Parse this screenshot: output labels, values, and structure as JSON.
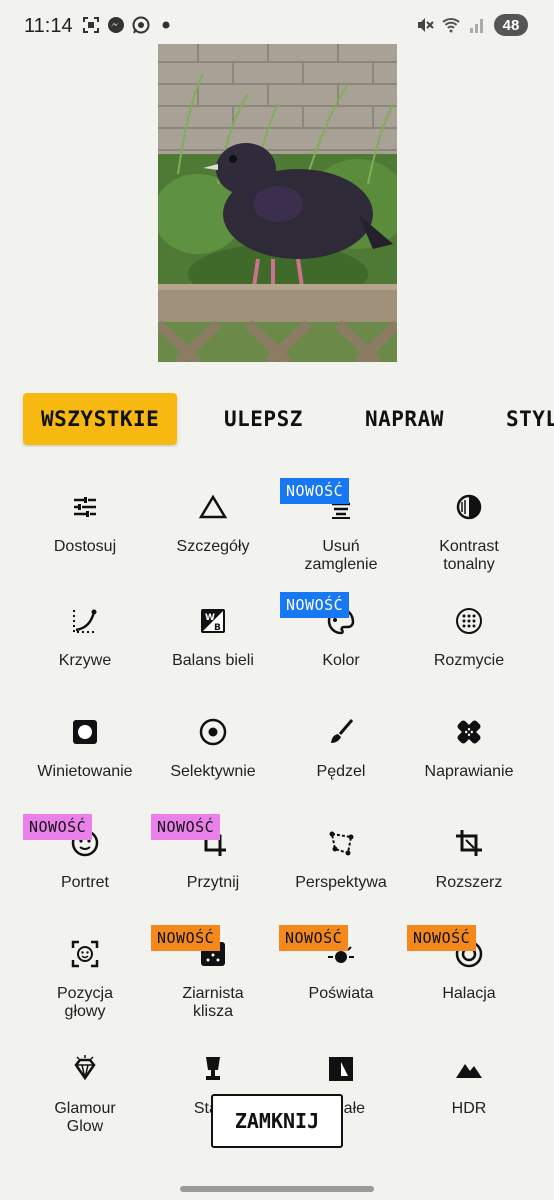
{
  "status_bar": {
    "time": "11:14",
    "battery": "48",
    "left_icons": [
      "screenshot-icon",
      "messenger-icon",
      "whatsapp-icon",
      "dot-icon"
    ],
    "right_icons": [
      "mute-icon",
      "wifi-icon",
      "signal-icon"
    ]
  },
  "photo": {
    "description_icon": "pigeon-photo"
  },
  "tabs": [
    {
      "label": "WSZYSTKIE",
      "active": true
    },
    {
      "label": "ULEPSZ",
      "active": false
    },
    {
      "label": "NAPRAW",
      "active": false
    },
    {
      "label": "STYL",
      "active": false
    }
  ],
  "badge_text": "NOWOŚĆ",
  "tools": [
    {
      "label": "Dostosuj",
      "icon": "sliders-icon"
    },
    {
      "label": "Szczegóły",
      "icon": "triangle-icon"
    },
    {
      "label": "Usuń\nzamglenie",
      "icon": "dehaze-icon",
      "badge": "blue"
    },
    {
      "label": "Kontrast\ntonalny",
      "icon": "tonal-contrast-icon"
    },
    {
      "label": "Krzywe",
      "icon": "curves-icon"
    },
    {
      "label": "Balans bieli",
      "icon": "white-balance-icon"
    },
    {
      "label": "Kolor",
      "icon": "palette-icon",
      "badge": "blue"
    },
    {
      "label": "Rozmycie",
      "icon": "blur-icon"
    },
    {
      "label": "Winietowanie",
      "icon": "vignette-icon"
    },
    {
      "label": "Selektywnie",
      "icon": "selective-icon"
    },
    {
      "label": "Pędzel",
      "icon": "brush-icon"
    },
    {
      "label": "Naprawianie",
      "icon": "healing-icon"
    },
    {
      "label": "Portret",
      "icon": "portrait-icon",
      "badge": "pink"
    },
    {
      "label": "Przytnij",
      "icon": "crop-icon",
      "badge": "pink"
    },
    {
      "label": "Perspektywa",
      "icon": "perspective-icon"
    },
    {
      "label": "Rozszerz",
      "icon": "expand-icon"
    },
    {
      "label": "Pozycja\ngłowy",
      "icon": "head-pose-icon"
    },
    {
      "label": "Ziarnista\nklisza",
      "icon": "grainy-film-icon",
      "badge": "orange"
    },
    {
      "label": "Poświata",
      "icon": "glow-icon",
      "badge": "orange"
    },
    {
      "label": "Halacja",
      "icon": "halation-icon",
      "badge": "orange"
    },
    {
      "label": "Glamour\nGlow",
      "icon": "glamour-glow-icon"
    },
    {
      "label": "Stara",
      "icon": "lamp-icon"
    },
    {
      "label": "o-białe",
      "icon": "black-white-icon"
    },
    {
      "label": "HDR",
      "icon": "hdr-icon"
    }
  ],
  "close_button": "ZAMKNIJ"
}
